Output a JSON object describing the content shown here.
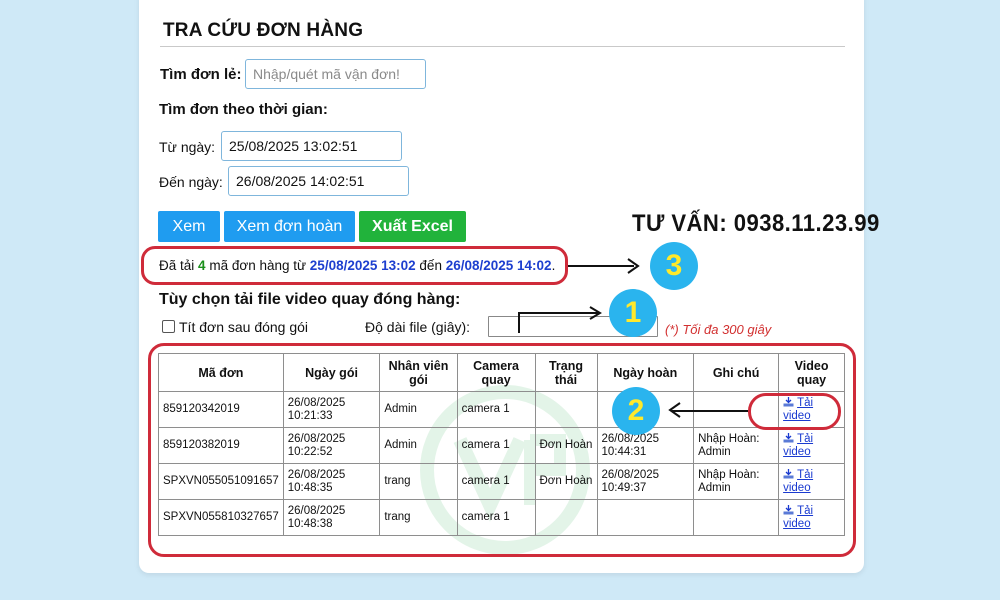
{
  "header": {
    "title": "TRA CỨU ĐƠN HÀNG"
  },
  "single_search": {
    "label": "Tìm đơn lẻ:",
    "placeholder": "Nhập/quét mã vận đơn!"
  },
  "time_search": {
    "heading": "Tìm đơn theo thời gian:",
    "from_label": "Từ ngày:",
    "from_value": "25/08/2025 13:02:51",
    "to_label": "Đến ngày:",
    "to_value": "26/08/2025 14:02:51"
  },
  "buttons": {
    "view": "Xem",
    "view_returns": "Xem đơn hoàn",
    "export_excel": "Xuất Excel"
  },
  "hotline": "TƯ VẤN: 0938.11.23.99",
  "status": {
    "prefix": "Đã tải",
    "count": "4",
    "middle": "mã đơn hàng từ",
    "from": "25/08/2025 13:02",
    "joiner": "đến",
    "to": "26/08/2025 14:02",
    "suffix": "."
  },
  "video_options": {
    "heading": "Tùy chọn tải file video quay đóng hàng:",
    "beep_label": "Tít đơn sau đóng gói",
    "beep_checked": false,
    "duration_label": "Độ dài file (giây):",
    "duration_value": "",
    "max_note": "(*) Tối đa 300 giây"
  },
  "annotations": {
    "one": "1",
    "two": "2",
    "three": "3"
  },
  "table": {
    "columns": [
      "Mã đơn",
      "Ngày gói",
      "Nhân viên gói",
      "Camera quay",
      "Trạng thái",
      "Ngày hoàn",
      "Ghi chú",
      "Video quay"
    ],
    "rows": [
      {
        "order_id": "859120342019",
        "packed_date": "26/08/2025",
        "packed_time": "10:21:33",
        "staff": "Admin",
        "camera": "camera 1",
        "status": "",
        "return_date": "",
        "return_time": "",
        "note_1": "",
        "note_2": "",
        "video_1": "Tải",
        "video_2": "video"
      },
      {
        "order_id": "859120382019",
        "packed_date": "26/08/2025",
        "packed_time": "10:22:52",
        "staff": "Admin",
        "camera": "camera 1",
        "status": "Đơn Hoàn",
        "return_date": "26/08/2025",
        "return_time": "10:44:31",
        "note_1": "Nhập Hoàn:",
        "note_2": "Admin",
        "video_1": "Tải",
        "video_2": "video"
      },
      {
        "order_id": "SPXVN055051091657",
        "packed_date": "26/08/2025",
        "packed_time": "10:48:35",
        "staff": "trang",
        "camera": "camera 1",
        "status": "Đơn Hoàn",
        "return_date": "26/08/2025",
        "return_time": "10:49:37",
        "note_1": "Nhập Hoàn:",
        "note_2": "Admin",
        "video_1": "Tải",
        "video_2": "video"
      },
      {
        "order_id": "SPXVN055810327657",
        "packed_date": "26/08/2025",
        "packed_time": "10:48:38",
        "staff": "trang",
        "camera": "camera 1",
        "status": "",
        "return_date": "",
        "return_time": "",
        "note_1": "",
        "note_2": "",
        "video_1": "Tải",
        "video_2": "video"
      }
    ]
  },
  "colors": {
    "accent_blue": "#1f9cf0",
    "excel_green": "#21b33b",
    "highlight_red": "#cf2b3a",
    "badge_blue": "#2ab4ee",
    "badge_digit": "#ffe92b"
  }
}
